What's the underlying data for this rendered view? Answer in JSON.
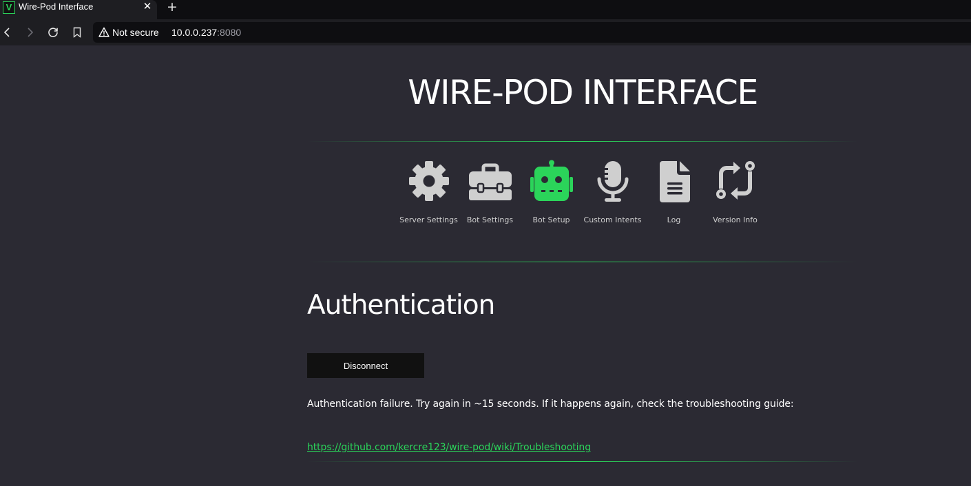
{
  "browser": {
    "tab_title": "Wire-Pod Interface",
    "tab_close_icon": "close-icon",
    "new_tab_icon": "plus-icon",
    "favicon_letter": "V",
    "security_label": "Not secure",
    "url_host": "10.0.0.237",
    "url_port": ":8080",
    "close_glyph": "✕",
    "new_tab_glyph": "+"
  },
  "header": {
    "title": "WIRE-POD INTERFACE"
  },
  "nav": {
    "items": [
      {
        "label": "Server Settings",
        "icon": "gear-icon",
        "color": "#cfcfcf"
      },
      {
        "label": "Bot Settings",
        "icon": "toolbox-icon",
        "color": "#cfcfcf"
      },
      {
        "label": "Bot Setup",
        "icon": "robot-icon",
        "color": "#2bd45a"
      },
      {
        "label": "Custom Intents",
        "icon": "microphone-icon",
        "color": "#cfcfcf"
      },
      {
        "label": "Log",
        "icon": "document-icon",
        "color": "#cfcfcf"
      },
      {
        "label": "Version Info",
        "icon": "sync-icon",
        "color": "#cfcfcf"
      }
    ]
  },
  "main": {
    "heading": "Authentication",
    "disconnect_label": "Disconnect",
    "message": "Authentication failure. Try again in ~15 seconds. If it happens again, check the troubleshooting guide:",
    "link_text": "https://github.com/kercre123/wire-pod/wiki/Troubleshooting"
  },
  "colors": {
    "background": "#2b2a33",
    "accent": "#2bd45a",
    "icon_gray": "#cfcfcf",
    "button_bg": "#111111"
  }
}
